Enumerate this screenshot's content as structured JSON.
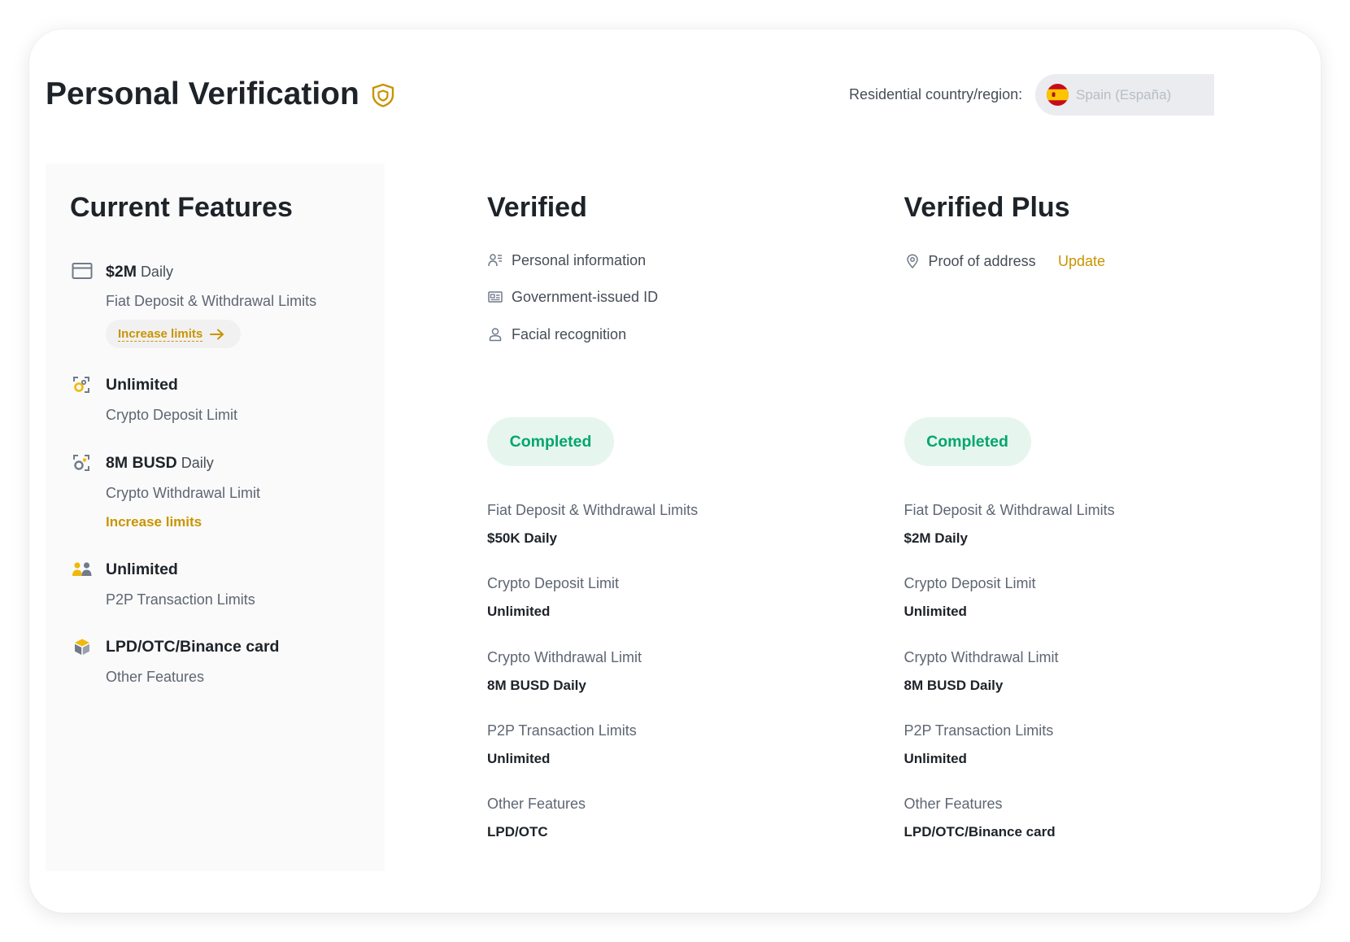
{
  "header": {
    "title": "Personal Verification",
    "title_icon": "shield-icon",
    "country_label": "Residential country/region:",
    "country_value": "Spain (España)",
    "country_flag_icon": "spain-flag-icon"
  },
  "current_features": {
    "title": "Current Features",
    "items": [
      {
        "icon": "card-icon",
        "value": "$2M",
        "unit": "Daily",
        "label": "Fiat Deposit & Withdrawal Limits",
        "action": "Increase limits",
        "action_icon": "arrow-right-icon"
      },
      {
        "icon": "crypto-deposit-icon",
        "value": "Unlimited",
        "label": "Crypto Deposit Limit"
      },
      {
        "icon": "crypto-withdrawal-icon",
        "value": "8M BUSD",
        "unit": "Daily",
        "label": "Crypto Withdrawal Limit",
        "action": "Increase limits"
      },
      {
        "icon": "users-icon",
        "value": "Unlimited",
        "label": "P2P Transaction Limits"
      },
      {
        "icon": "box-icon",
        "value": "LPD/OTC/Binance card",
        "label": "Other Features"
      }
    ]
  },
  "levels": [
    {
      "title": "Verified",
      "requirements": [
        {
          "icon": "personal-info-icon",
          "label": "Personal information"
        },
        {
          "icon": "id-card-icon",
          "label": "Government-issued ID"
        },
        {
          "icon": "face-icon",
          "label": "Facial recognition"
        }
      ],
      "status": "Completed",
      "limits": [
        {
          "label": "Fiat Deposit & Withdrawal Limits",
          "value": "$50K Daily"
        },
        {
          "label": "Crypto Deposit Limit",
          "value": "Unlimited"
        },
        {
          "label": "Crypto Withdrawal Limit",
          "value": "8M BUSD Daily"
        },
        {
          "label": "P2P Transaction Limits",
          "value": "Unlimited"
        },
        {
          "label": "Other Features",
          "value": "LPD/OTC"
        }
      ]
    },
    {
      "title": "Verified Plus",
      "requirements": [
        {
          "icon": "location-pin-icon",
          "label": "Proof of address",
          "action": "Update"
        }
      ],
      "status": "Completed",
      "limits": [
        {
          "label": "Fiat Deposit & Withdrawal Limits",
          "value": "$2M Daily"
        },
        {
          "label": "Crypto Deposit Limit",
          "value": "Unlimited"
        },
        {
          "label": "Crypto Withdrawal Limit",
          "value": "8M BUSD Daily"
        },
        {
          "label": "P2P Transaction Limits",
          "value": "Unlimited"
        },
        {
          "label": "Other Features",
          "value": "LPD/OTC/Binance card"
        }
      ]
    }
  ],
  "colors": {
    "accent": "#c99400",
    "success": "#03a66d",
    "success_bg": "#e6f6ee",
    "text_primary": "#1e2329",
    "text_secondary": "#474d57"
  }
}
